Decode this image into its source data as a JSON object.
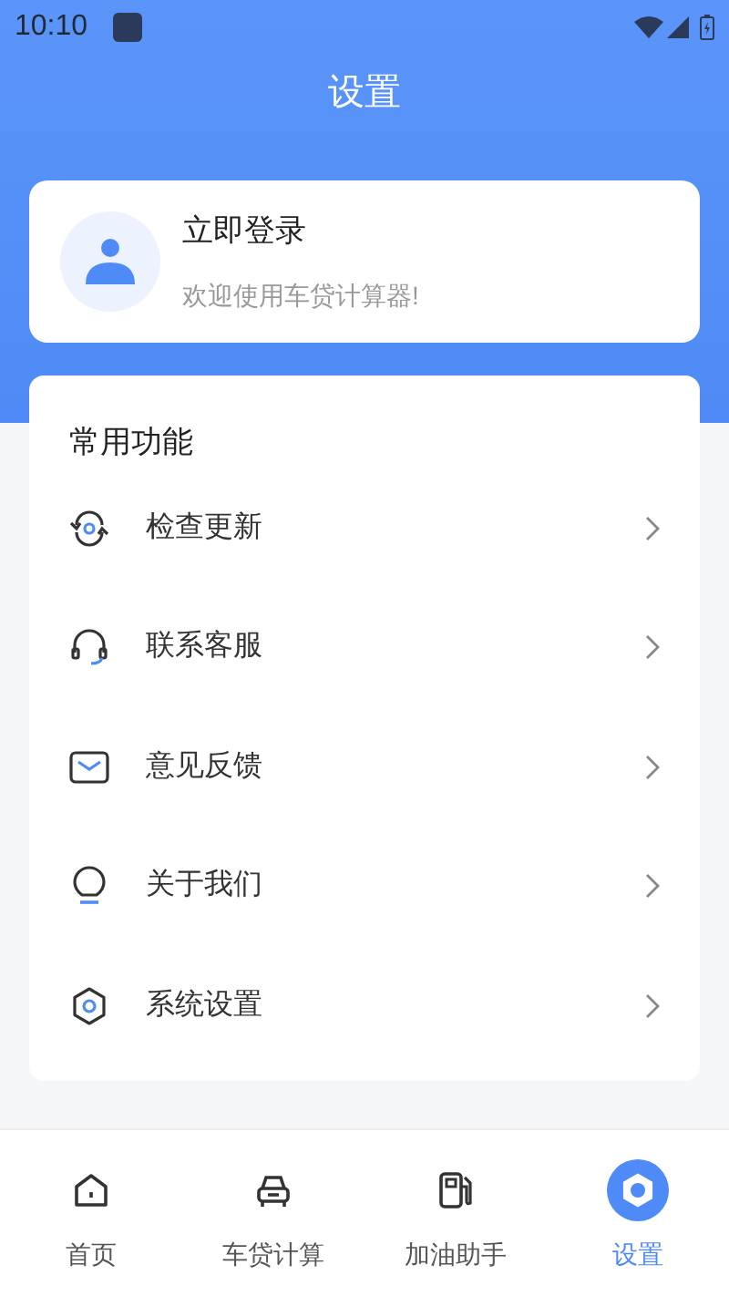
{
  "status_bar": {
    "time": "10:10"
  },
  "header": {
    "title": "设置"
  },
  "login_card": {
    "title": "立即登录",
    "subtitle": "欢迎使用车贷计算器!"
  },
  "section": {
    "title": "常用功能",
    "items": [
      {
        "kind": "update",
        "label": "检查更新"
      },
      {
        "kind": "service",
        "label": "联系客服"
      },
      {
        "kind": "feedback",
        "label": "意见反馈"
      },
      {
        "kind": "about",
        "label": "关于我们"
      },
      {
        "kind": "settings",
        "label": "系统设置"
      }
    ]
  },
  "bottom_nav": [
    {
      "kind": "home",
      "label": "首页",
      "selected": false
    },
    {
      "kind": "car",
      "label": "车贷计算",
      "selected": false
    },
    {
      "kind": "fuel",
      "label": "加油助手",
      "selected": false
    },
    {
      "kind": "settings",
      "label": "设置",
      "selected": true
    }
  ]
}
